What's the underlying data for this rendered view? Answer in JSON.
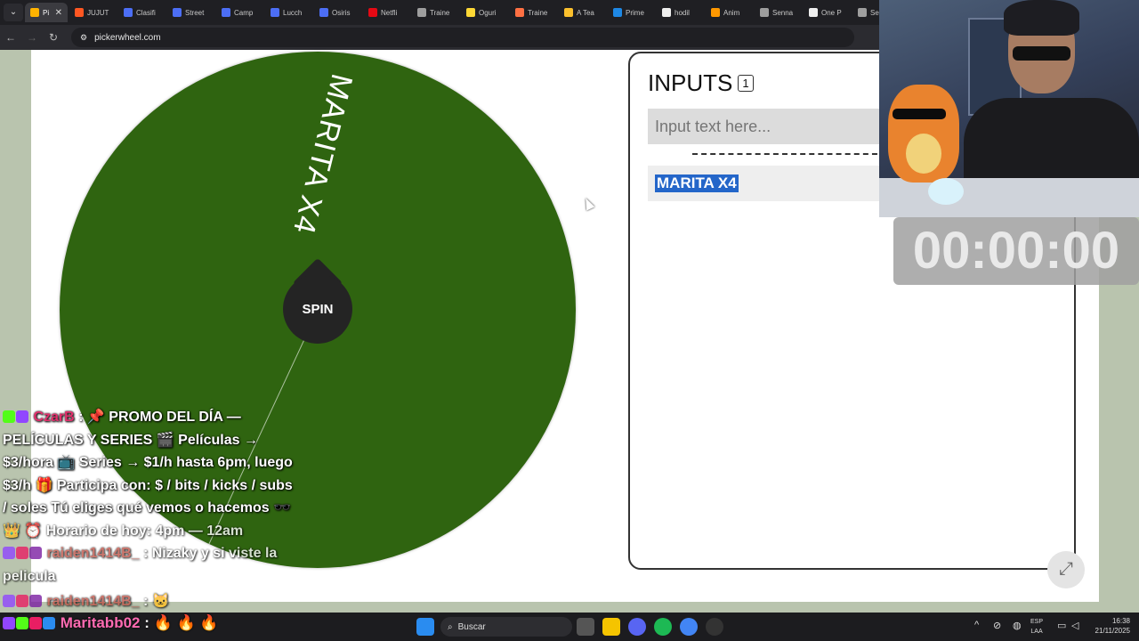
{
  "browser": {
    "tabs": [
      {
        "label": "Pi",
        "color": "#ffb300",
        "active": true
      },
      {
        "label": "JUJUT",
        "color": "#ff5722"
      },
      {
        "label": "Clasifi",
        "color": "#4c6ef5"
      },
      {
        "label": "Street",
        "color": "#4c6ef5"
      },
      {
        "label": "Camp",
        "color": "#4c6ef5"
      },
      {
        "label": "Lucch",
        "color": "#4c6ef5"
      },
      {
        "label": "Osiris",
        "color": "#4c6ef5"
      },
      {
        "label": "Netfli",
        "color": "#e50914"
      },
      {
        "label": "Traine",
        "color": "#9e9e9e"
      },
      {
        "label": "Oguri",
        "color": "#fdd835"
      },
      {
        "label": "Traine",
        "color": "#ff7043"
      },
      {
        "label": "A Tea",
        "color": "#fbc02d"
      },
      {
        "label": "Prime",
        "color": "#1e88e5"
      },
      {
        "label": "hodil",
        "color": "#eeeeee"
      },
      {
        "label": "Anim",
        "color": "#ff9800"
      },
      {
        "label": "Senna",
        "color": "#9e9e9e"
      },
      {
        "label": "One P",
        "color": "#eeeeee"
      },
      {
        "label": "Senna",
        "color": "#9e9e9e"
      }
    ],
    "url": "pickerwheel.com",
    "close_glyph": "✕",
    "back_glyph": "←",
    "forward_glyph": "→",
    "reload_glyph": "↻",
    "menu_glyph": "⌄"
  },
  "wheel": {
    "segment_label": "MARITA X4",
    "segment_color": "#2f6410",
    "spin_label": "SPIN"
  },
  "inputs": {
    "title": "INPUTS",
    "count": "1",
    "placeholder": "Input text here...",
    "entries": [
      "MARITA X4"
    ]
  },
  "expand_glyph": "⤢",
  "timer": "00:00:00",
  "chat": {
    "messages": [
      {
        "user": "CzarB",
        "sep": ":",
        "text": "📌 PROMO DEL DÍA —"
      },
      {
        "text": "PELÍCULAS Y SERIES 🎬 Películas →"
      },
      {
        "text": "$3/hora 📺 Series → $1/h hasta 6pm, luego"
      },
      {
        "text": "$3/h 🎁 Participa con: $ / bits / kicks / subs"
      },
      {
        "text": "/ soles Tú eliges qué vemos o hacemos 🕶️"
      },
      {
        "text": "👑 ⏰ Horario de hoy: 4pm — 12am"
      },
      {
        "user": "raiden1414B_",
        "sep": ":",
        "text": "Nizaky y si viste la"
      },
      {
        "text": "pelicula"
      },
      {
        "user": "raiden1414B_",
        "sep": ":",
        "text": "🐱"
      }
    ],
    "bottom": {
      "user": "Maritabb02",
      "sep": ":",
      "text": "🔥 🔥 🔥"
    }
  },
  "taskbar": {
    "search_label": "Buscar",
    "lang_top": "ESP",
    "lang_bottom": "LAA",
    "time": "16:38",
    "date": "21/11/2025"
  }
}
